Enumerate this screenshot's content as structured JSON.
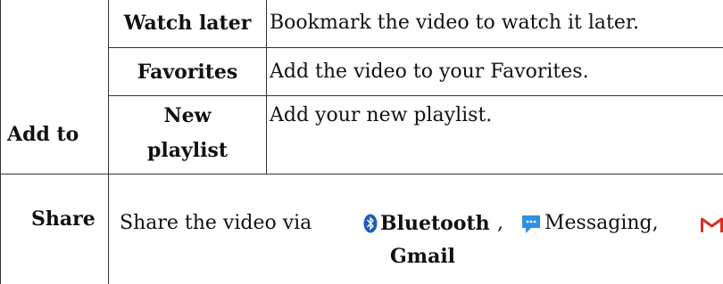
{
  "add_to": {
    "label": "Add to",
    "rows": [
      {
        "name": "Watch later",
        "description": "Bookmark the video to watch it later."
      },
      {
        "name": "Favorites",
        "description": "Add the video to your Favorites."
      },
      {
        "name_line1": "New",
        "name_line2": "playlist",
        "description": "Add your new playlist."
      }
    ]
  },
  "share": {
    "label": "Share",
    "prefix": "Share the video via",
    "bluetooth": "Bluetooth",
    "comma1": ",",
    "messaging": "Messaging,",
    "gmail": "Gmail",
    "icons": [
      "bluetooth-icon",
      "messaging-icon",
      "gmail-icon"
    ],
    "colors": {
      "bluetooth": "#1a5fb4",
      "messaging": "#2f8fe0",
      "gmail": "#d93025"
    }
  }
}
